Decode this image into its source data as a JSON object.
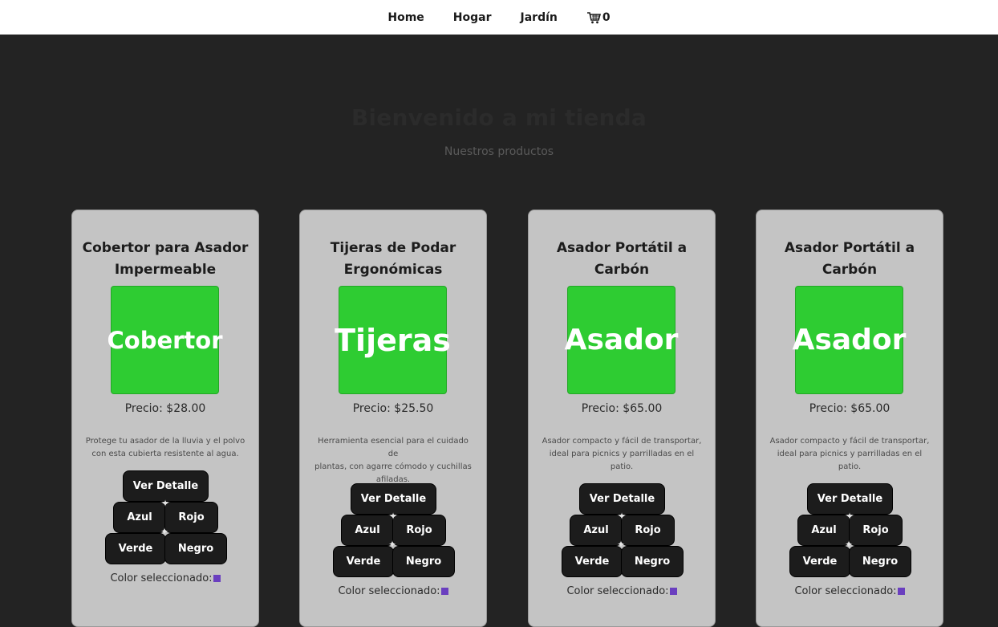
{
  "nav": {
    "links": [
      "Home",
      "Hogar",
      "Jardín"
    ],
    "cart_icon": "cart-icon",
    "cart_count": "0"
  },
  "hero": {
    "title": "Bienvenido a mi tienda",
    "subtitle": "Nuestros productos"
  },
  "colors": {
    "background": "#232323",
    "card": "#c4c4c4",
    "thumb": "#2ecc32",
    "button": "#1c1c1c",
    "selected_swatch": "#6a3fbf"
  },
  "products": [
    {
      "title_line1": "Cobertor para Asador",
      "title_line2": "Impermeable",
      "thumb": "Cobertor",
      "price": "Precio: $28.00",
      "desc_lines": [
        "Protege tu asador de la lluvia y el polvo",
        "con esta cubierta resistente al agua."
      ],
      "detail": "Ver Detalle",
      "colors": [
        "Azul",
        "Rojo",
        "Verde",
        "Negro"
      ],
      "selected_label": "Color seleccionado:"
    },
    {
      "title_line1": "Tijeras de Podar",
      "title_line2": "Ergonómicas",
      "thumb": "Tijeras",
      "price": "Precio: $25.50",
      "desc_lines": [
        "Herramienta esencial para el cuidado de",
        "plantas, con agarre cómodo y cuchillas",
        "afiladas."
      ],
      "detail": "Ver Detalle",
      "colors": [
        "Azul",
        "Rojo",
        "Verde",
        "Negro"
      ],
      "selected_label": "Color seleccionado:"
    },
    {
      "title_line1": "Asador Portátil a",
      "title_line2": "Carbón",
      "thumb": "Asador",
      "price": "Precio: $65.00",
      "desc_lines": [
        "Asador compacto y fácil de transportar,",
        "ideal para picnics y parrilladas en el",
        "patio."
      ],
      "detail": "Ver Detalle",
      "colors": [
        "Azul",
        "Rojo",
        "Verde",
        "Negro"
      ],
      "selected_label": "Color seleccionado:"
    },
    {
      "title_line1": "Asador Portátil a",
      "title_line2": "Carbón",
      "thumb": "Asador",
      "price": "Precio: $65.00",
      "desc_lines": [
        "Asador compacto y fácil de transportar,",
        "ideal para picnics y parrilladas en el",
        "patio."
      ],
      "detail": "Ver Detalle",
      "colors": [
        "Azul",
        "Rojo",
        "Verde",
        "Negro"
      ],
      "selected_label": "Color seleccionado:"
    }
  ]
}
